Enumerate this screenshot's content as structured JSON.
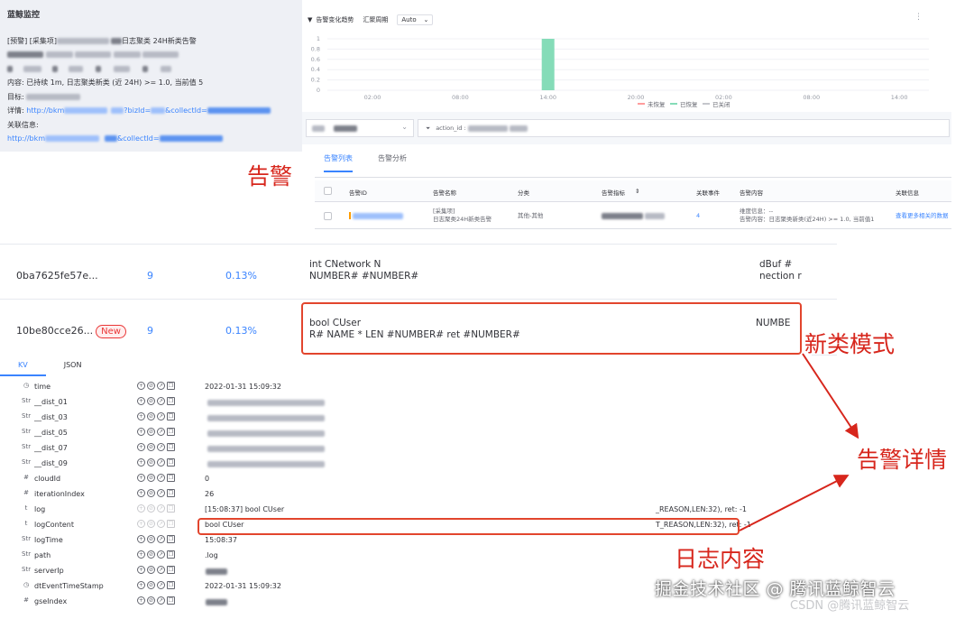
{
  "notification": {
    "title": "蓝鲸监控",
    "line_alert": "[预警] [采集项]",
    "line_alert_tail": "日志聚类 24H新类告警",
    "content": "内容: 已持续 1m, 日志聚类新类 (近 24H) >= 1.0, 当前值 5",
    "target_label": "目标:",
    "detail_label": "详情: ",
    "detail_link_a": "http://bkm",
    "detail_link_b": "?bizId=",
    "detail_link_c": "&collectId=",
    "related_label": "关联信息:",
    "related_link_a": "http://bkm",
    "related_link_b": "&collectId="
  },
  "trend": {
    "title": "告警变化趋势",
    "period_label": "汇聚周期",
    "period_value": "Auto",
    "more_icon": "more-icon"
  },
  "chart_data": {
    "type": "bar",
    "title": "告警变化趋势",
    "x_ticks": [
      "02:00",
      "08:00",
      "14:00",
      "20:00",
      "02:00",
      "08:00",
      "14:00"
    ],
    "y_ticks": [
      "0",
      "0.2",
      "0.4",
      "0.6",
      "0.8",
      "1"
    ],
    "ylim": [
      0,
      1
    ],
    "series": [
      {
        "name": "未恢复",
        "color": "#ff9c9c",
        "values": []
      },
      {
        "name": "已恢复",
        "color": "#85dcb8",
        "values": [
          {
            "x": "14:00",
            "y": 1
          }
        ]
      },
      {
        "name": "已关闭",
        "color": "#c4c6cc",
        "values": []
      }
    ],
    "legend_position": "bottom-right",
    "grid": true
  },
  "filters": {
    "query": "action_id : "
  },
  "alerts": {
    "tabs": [
      "告警列表",
      "告警分析"
    ],
    "columns": [
      "告警ID",
      "告警名称",
      "分类",
      "告警指标",
      "关联事件",
      "告警内容",
      "关联信息"
    ],
    "row": {
      "name_line1": "[采集项]",
      "name_line2": "日志聚类24H新类告警",
      "category": "其他-其他",
      "events": "4",
      "content_line1": "维度信息：--",
      "content_line2": "告警内容：日志聚类新类(近24H) >= 1.0, 当前值1",
      "related": "查看更多相关的数据"
    }
  },
  "patterns": [
    {
      "signature": "0ba7625fe57e...",
      "count": "9",
      "percent": "0.13%",
      "pattern_l1": "int CNetwork N",
      "pattern_l2": "NUMBER# #NUMBER#",
      "pattern_r1": "dBuf #",
      "pattern_r2": "nection r",
      "is_new": false
    },
    {
      "signature": "10be80cce26...",
      "count": "9",
      "percent": "0.13%",
      "pattern_l1": "bool CUser",
      "pattern_l2": "R# NAME * LEN #NUMBER# ret #NUMBER#",
      "pattern_r1": "NUMBE",
      "pattern_r2": "",
      "is_new": true,
      "new_label": "New"
    }
  ],
  "kv": {
    "tabs": [
      "KV",
      "JSON"
    ],
    "rows": [
      {
        "type": "◷",
        "field": "time",
        "value": "2022-01-31 15:09:32",
        "value2": ""
      },
      {
        "type": "Str",
        "field": "__dist_01",
        "value": "",
        "value2": ""
      },
      {
        "type": "Str",
        "field": "__dist_03",
        "value": "",
        "value2": ""
      },
      {
        "type": "Str",
        "field": "__dist_05",
        "value": "",
        "value2": ""
      },
      {
        "type": "Str",
        "field": "__dist_07",
        "value": "",
        "value2": ""
      },
      {
        "type": "Str",
        "field": "__dist_09",
        "value": "",
        "value2": ""
      },
      {
        "type": "#",
        "field": "cloudId",
        "value": "0",
        "value2": ""
      },
      {
        "type": "#",
        "field": "iterationIndex",
        "value": "26",
        "value2": ""
      },
      {
        "type": "t",
        "field": "log",
        "value": "[15:08:37] bool CUser",
        "value2": "_REASON,LEN:32), ret: -1"
      },
      {
        "type": "t",
        "field": "logContent",
        "value": "bool CUser",
        "value2": "T_REASON,LEN:32), ret: -1"
      },
      {
        "type": "Str",
        "field": "logTime",
        "value": "15:08:37",
        "value2": ""
      },
      {
        "type": "Str",
        "field": "path",
        "value": ".log",
        "value2": ""
      },
      {
        "type": "Str",
        "field": "serverIp",
        "value": "",
        "value2": ""
      },
      {
        "type": "◷",
        "field": "dtEventTimeStamp",
        "value": "2022-01-31 15:09:32",
        "value2": ""
      },
      {
        "type": "#",
        "field": "gseIndex",
        "value": "",
        "value2": ""
      }
    ]
  },
  "annotations": {
    "alert": "告警",
    "new_pattern": "新类模式",
    "alert_detail": "告警详情",
    "log_content": "日志内容",
    "color": "#d7261c"
  },
  "watermark": "掘金技术社区 @ 腾讯蓝鲸智云",
  "csdn": "CSDN @腾讯蓝鲸智云"
}
